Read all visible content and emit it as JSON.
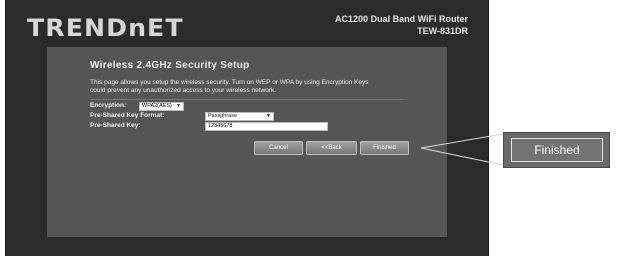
{
  "header": {
    "brand": "TRENDnET",
    "product_line_1": "AC1200 Dual Band WiFi Router",
    "product_line_2": "TEW-831DR"
  },
  "page": {
    "title": "Wireless 2.4GHz Security Setup",
    "description_line_1": "This page allows you setup the wireless security. Turn on WEP or WPA by using Encryption Keys",
    "description_line_2": "could prevent any unauthorized access to your wireless network."
  },
  "form": {
    "encryption_label": "Encryption:",
    "encryption_value": "WPA2(AES)",
    "psk_format_label": "Pre-Shared Key Format:",
    "psk_format_value": "Passphrase",
    "psk_label": "Pre-Shared Key:",
    "psk_value": "12345678"
  },
  "buttons": {
    "cancel": "Cancel",
    "back": "<<Back",
    "finished": "Finished"
  },
  "callout": {
    "label": "Finished"
  },
  "icons": {
    "dropdown": "chevron-down-icon"
  }
}
